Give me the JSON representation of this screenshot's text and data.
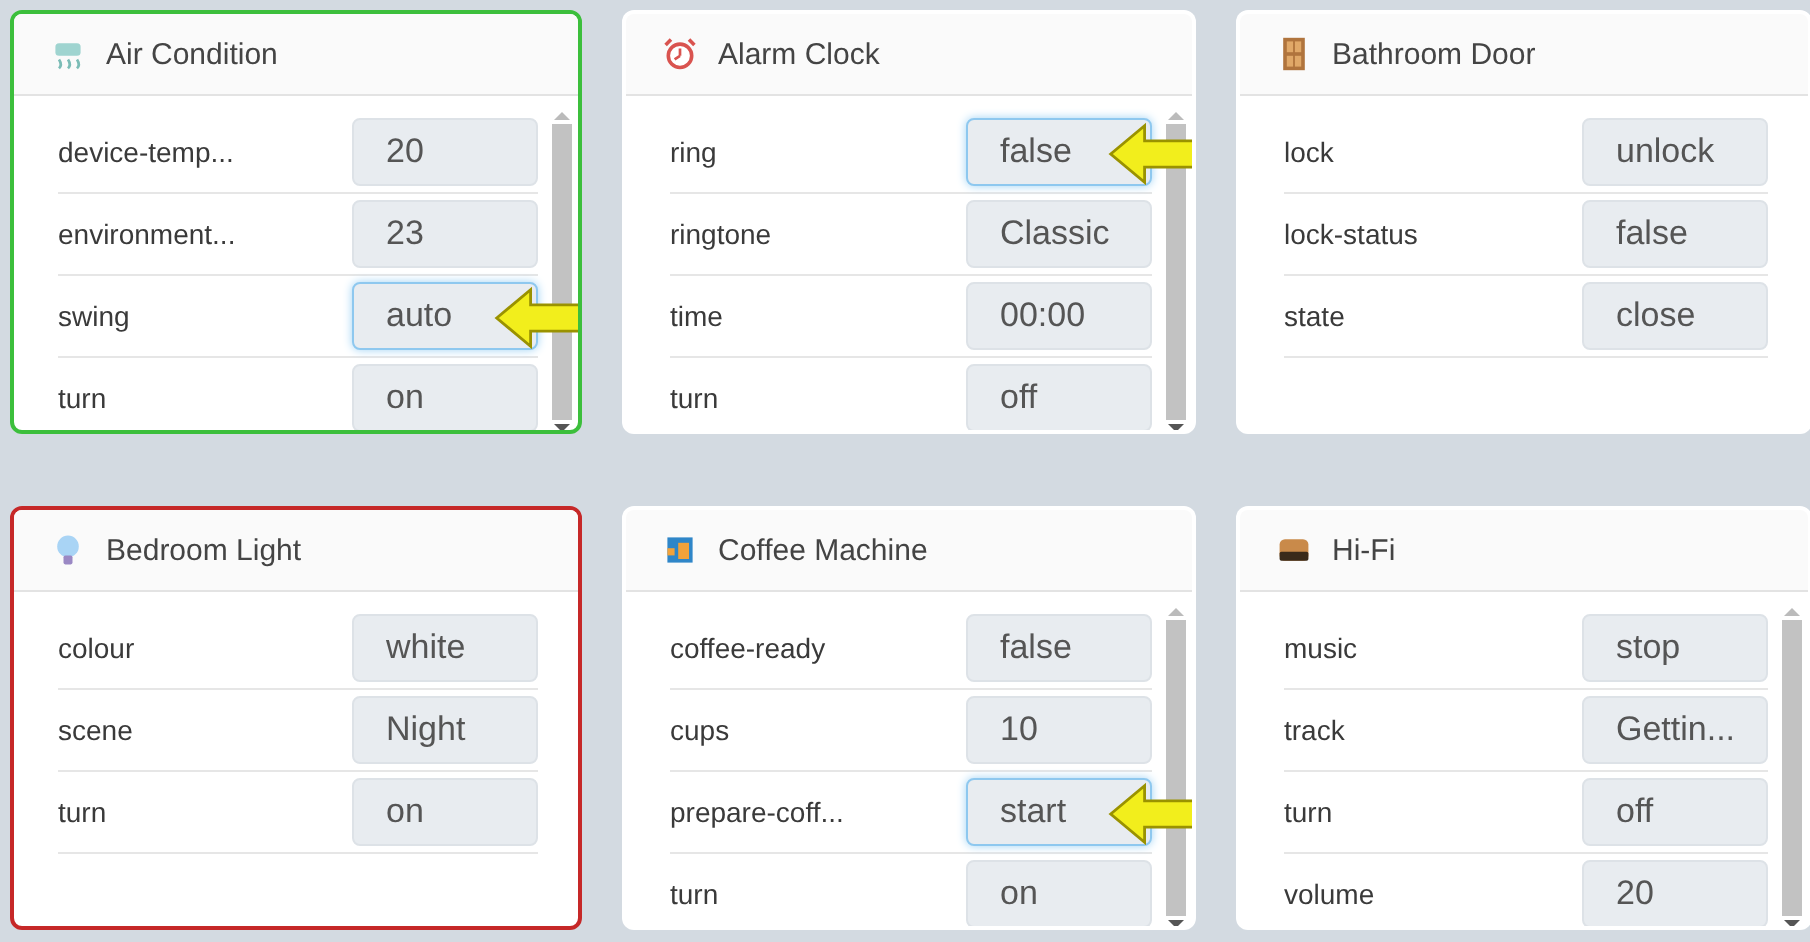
{
  "devices": [
    {
      "name": "Air Condition",
      "kind": "air-conditioner",
      "color": "#3cbf3c",
      "scrollable": true,
      "properties": [
        {
          "label": "device-temp...",
          "value": "20",
          "focused": false
        },
        {
          "label": "environment...",
          "value": "23",
          "focused": false
        },
        {
          "label": "swing",
          "value": "auto",
          "focused": true
        },
        {
          "label": "turn",
          "value": "on",
          "focused": false
        }
      ]
    },
    {
      "name": "Alarm Clock",
      "kind": "alarm-clock",
      "scrollable": true,
      "properties": [
        {
          "label": "ring",
          "value": "false",
          "focused": true
        },
        {
          "label": "ringtone",
          "value": "Classic",
          "focused": false
        },
        {
          "label": "time",
          "value": "00:00",
          "focused": false
        },
        {
          "label": "turn",
          "value": "off",
          "focused": false
        }
      ]
    },
    {
      "name": "Bathroom Door",
      "kind": "door",
      "scrollable": false,
      "properties": [
        {
          "label": "lock",
          "value": "unlock",
          "focused": false
        },
        {
          "label": "lock-status",
          "value": "false",
          "focused": false
        },
        {
          "label": "state",
          "value": "close",
          "focused": false
        }
      ]
    },
    {
      "name": "Bedroom Light",
      "kind": "light-bulb",
      "color": "#c62828",
      "scrollable": false,
      "properties": [
        {
          "label": "colour",
          "value": "white",
          "focused": false
        },
        {
          "label": "scene",
          "value": "Night",
          "focused": false
        },
        {
          "label": "turn",
          "value": "on",
          "focused": false
        }
      ]
    },
    {
      "name": "Coffee Machine",
      "kind": "coffee-machine",
      "scrollable": true,
      "properties": [
        {
          "label": "coffee-ready",
          "value": "false",
          "focused": false
        },
        {
          "label": "cups",
          "value": "10",
          "focused": false
        },
        {
          "label": "prepare-coff...",
          "value": "start",
          "focused": true
        },
        {
          "label": "turn",
          "value": "on",
          "focused": false
        }
      ]
    },
    {
      "name": "Hi-Fi",
      "kind": "radio",
      "scrollable": true,
      "properties": [
        {
          "label": "music",
          "value": "stop",
          "focused": false
        },
        {
          "label": "track",
          "value": "Gettin...",
          "focused": false
        },
        {
          "label": "turn",
          "value": "off",
          "focused": false
        },
        {
          "label": "volume",
          "value": "20",
          "focused": false
        }
      ]
    }
  ]
}
